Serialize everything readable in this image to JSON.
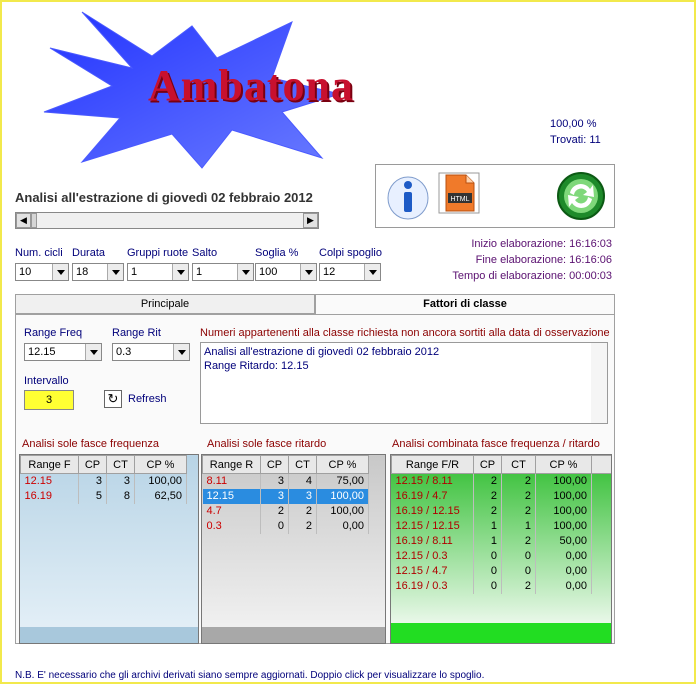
{
  "logo": {
    "text": "Ambatona"
  },
  "stats": {
    "percent": "100,00 %",
    "found": "Trovati: 11"
  },
  "toolbar": {
    "info_icon": "info-icon",
    "html_icon": "html-export-icon",
    "html_label": "HTML",
    "refresh_icon": "recycle-refresh-icon"
  },
  "analysis_title": "Analisi all'estrazione di giovedì 02 febbraio 2012",
  "params": {
    "labels": {
      "cicli": "Num. cicli",
      "durata": "Durata",
      "gruppi": "Gruppi ruote",
      "salto": "Salto",
      "soglia": "Soglia %",
      "colpi": "Colpi spoglio"
    },
    "values": {
      "cicli": "10",
      "durata": "18",
      "gruppi": "1",
      "salto": "1",
      "soglia": "100",
      "colpi": "12"
    }
  },
  "elaborazione": {
    "inizio": "Inizio elaborazione: 16:16:03",
    "fine": "Fine elaborazione: 16:16:06",
    "tempo": "Tempo di elaborazione: 00:00:03"
  },
  "tabs": {
    "principale": "Principale",
    "fattori": "Fattori di classe"
  },
  "fattori": {
    "range_freq_label": "Range Freq",
    "range_freq_value": "12.15",
    "range_rit_label": "Range Rit",
    "range_rit_value": "0.3",
    "intervallo_label": "Intervallo",
    "intervallo_value": "3",
    "refresh_label": "Refresh",
    "memo_title": "Numeri appartenenti alla classe richiesta non ancora sortiti alla data di osservazione",
    "memo_line1": "Analisi all'estrazione di giovedì 02 febbraio 2012",
    "memo_line2": "Range Ritardo: 12.15"
  },
  "freq_section": {
    "title": "Analisi sole fasce frequenza",
    "headers": [
      "Range F",
      "CP",
      "CT",
      "CP %"
    ],
    "rows": [
      [
        "12.15",
        "3",
        "3",
        "100,00"
      ],
      [
        "16.19",
        "5",
        "8",
        "62,50"
      ]
    ]
  },
  "rit_section": {
    "title": "Analisi sole fasce ritardo",
    "headers": [
      "Range R",
      "CP",
      "CT",
      "CP %"
    ],
    "rows": [
      [
        "8.11",
        "3",
        "4",
        "75,00"
      ],
      [
        "12.15",
        "3",
        "3",
        "100,00"
      ],
      [
        "4.7",
        "2",
        "2",
        "100,00"
      ],
      [
        "0.3",
        "0",
        "2",
        "0,00"
      ]
    ],
    "selected_row": 1
  },
  "comb_section": {
    "title": "Analisi combinata fasce frequenza / ritardo",
    "headers": [
      "Range F/R",
      "CP",
      "CT",
      "CP %"
    ],
    "rows": [
      [
        "12.15 / 8.11",
        "2",
        "2",
        "100,00"
      ],
      [
        "16.19 / 4.7",
        "2",
        "2",
        "100,00"
      ],
      [
        "16.19 / 12.15",
        "2",
        "2",
        "100,00"
      ],
      [
        "12.15 / 12.15",
        "1",
        "1",
        "100,00"
      ],
      [
        "16.19 / 8.11",
        "1",
        "2",
        "50,00"
      ],
      [
        "12.15 / 0.3",
        "0",
        "0",
        "0,00"
      ],
      [
        "12.15 / 4.7",
        "0",
        "0",
        "0,00"
      ],
      [
        "16.19 / 0.3",
        "0",
        "2",
        "0,00"
      ]
    ]
  },
  "footer_note": "N.B. E' necessario che gli archivi derivati siano sempre aggiornati. Doppio click per visualizzare lo spoglio."
}
